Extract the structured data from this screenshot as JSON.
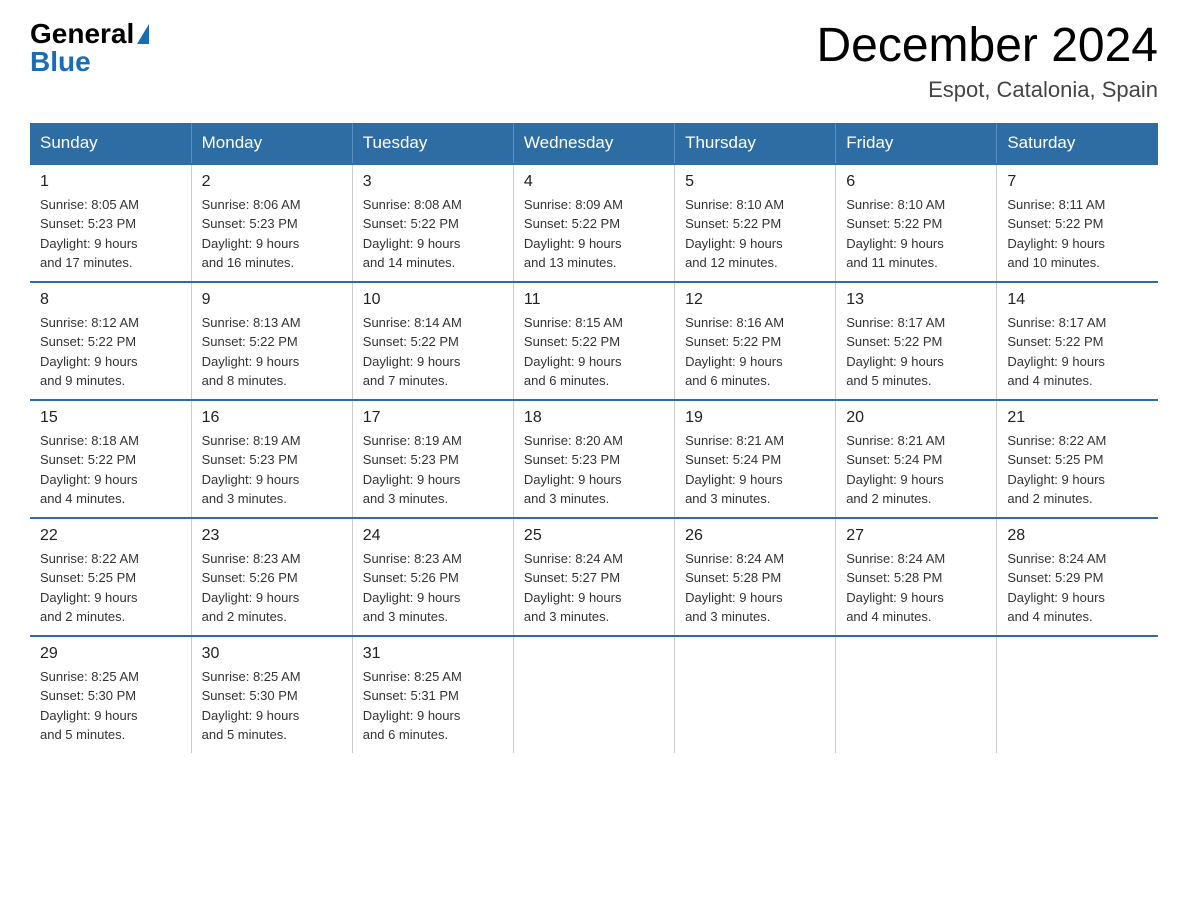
{
  "header": {
    "logo_general": "General",
    "logo_blue": "Blue",
    "title": "December 2024",
    "subtitle": "Espot, Catalonia, Spain"
  },
  "calendar": {
    "days_of_week": [
      "Sunday",
      "Monday",
      "Tuesday",
      "Wednesday",
      "Thursday",
      "Friday",
      "Saturday"
    ],
    "weeks": [
      [
        {
          "day": "1",
          "sunrise": "8:05 AM",
          "sunset": "5:23 PM",
          "daylight": "9 hours and 17 minutes."
        },
        {
          "day": "2",
          "sunrise": "8:06 AM",
          "sunset": "5:23 PM",
          "daylight": "9 hours and 16 minutes."
        },
        {
          "day": "3",
          "sunrise": "8:08 AM",
          "sunset": "5:22 PM",
          "daylight": "9 hours and 14 minutes."
        },
        {
          "day": "4",
          "sunrise": "8:09 AM",
          "sunset": "5:22 PM",
          "daylight": "9 hours and 13 minutes."
        },
        {
          "day": "5",
          "sunrise": "8:10 AM",
          "sunset": "5:22 PM",
          "daylight": "9 hours and 12 minutes."
        },
        {
          "day": "6",
          "sunrise": "8:10 AM",
          "sunset": "5:22 PM",
          "daylight": "9 hours and 11 minutes."
        },
        {
          "day": "7",
          "sunrise": "8:11 AM",
          "sunset": "5:22 PM",
          "daylight": "9 hours and 10 minutes."
        }
      ],
      [
        {
          "day": "8",
          "sunrise": "8:12 AM",
          "sunset": "5:22 PM",
          "daylight": "9 hours and 9 minutes."
        },
        {
          "day": "9",
          "sunrise": "8:13 AM",
          "sunset": "5:22 PM",
          "daylight": "9 hours and 8 minutes."
        },
        {
          "day": "10",
          "sunrise": "8:14 AM",
          "sunset": "5:22 PM",
          "daylight": "9 hours and 7 minutes."
        },
        {
          "day": "11",
          "sunrise": "8:15 AM",
          "sunset": "5:22 PM",
          "daylight": "9 hours and 6 minutes."
        },
        {
          "day": "12",
          "sunrise": "8:16 AM",
          "sunset": "5:22 PM",
          "daylight": "9 hours and 6 minutes."
        },
        {
          "day": "13",
          "sunrise": "8:17 AM",
          "sunset": "5:22 PM",
          "daylight": "9 hours and 5 minutes."
        },
        {
          "day": "14",
          "sunrise": "8:17 AM",
          "sunset": "5:22 PM",
          "daylight": "9 hours and 4 minutes."
        }
      ],
      [
        {
          "day": "15",
          "sunrise": "8:18 AM",
          "sunset": "5:22 PM",
          "daylight": "9 hours and 4 minutes."
        },
        {
          "day": "16",
          "sunrise": "8:19 AM",
          "sunset": "5:23 PM",
          "daylight": "9 hours and 3 minutes."
        },
        {
          "day": "17",
          "sunrise": "8:19 AM",
          "sunset": "5:23 PM",
          "daylight": "9 hours and 3 minutes."
        },
        {
          "day": "18",
          "sunrise": "8:20 AM",
          "sunset": "5:23 PM",
          "daylight": "9 hours and 3 minutes."
        },
        {
          "day": "19",
          "sunrise": "8:21 AM",
          "sunset": "5:24 PM",
          "daylight": "9 hours and 3 minutes."
        },
        {
          "day": "20",
          "sunrise": "8:21 AM",
          "sunset": "5:24 PM",
          "daylight": "9 hours and 2 minutes."
        },
        {
          "day": "21",
          "sunrise": "8:22 AM",
          "sunset": "5:25 PM",
          "daylight": "9 hours and 2 minutes."
        }
      ],
      [
        {
          "day": "22",
          "sunrise": "8:22 AM",
          "sunset": "5:25 PM",
          "daylight": "9 hours and 2 minutes."
        },
        {
          "day": "23",
          "sunrise": "8:23 AM",
          "sunset": "5:26 PM",
          "daylight": "9 hours and 2 minutes."
        },
        {
          "day": "24",
          "sunrise": "8:23 AM",
          "sunset": "5:26 PM",
          "daylight": "9 hours and 3 minutes."
        },
        {
          "day": "25",
          "sunrise": "8:24 AM",
          "sunset": "5:27 PM",
          "daylight": "9 hours and 3 minutes."
        },
        {
          "day": "26",
          "sunrise": "8:24 AM",
          "sunset": "5:28 PM",
          "daylight": "9 hours and 3 minutes."
        },
        {
          "day": "27",
          "sunrise": "8:24 AM",
          "sunset": "5:28 PM",
          "daylight": "9 hours and 4 minutes."
        },
        {
          "day": "28",
          "sunrise": "8:24 AM",
          "sunset": "5:29 PM",
          "daylight": "9 hours and 4 minutes."
        }
      ],
      [
        {
          "day": "29",
          "sunrise": "8:25 AM",
          "sunset": "5:30 PM",
          "daylight": "9 hours and 5 minutes."
        },
        {
          "day": "30",
          "sunrise": "8:25 AM",
          "sunset": "5:30 PM",
          "daylight": "9 hours and 5 minutes."
        },
        {
          "day": "31",
          "sunrise": "8:25 AM",
          "sunset": "5:31 PM",
          "daylight": "9 hours and 6 minutes."
        },
        null,
        null,
        null,
        null
      ]
    ]
  }
}
